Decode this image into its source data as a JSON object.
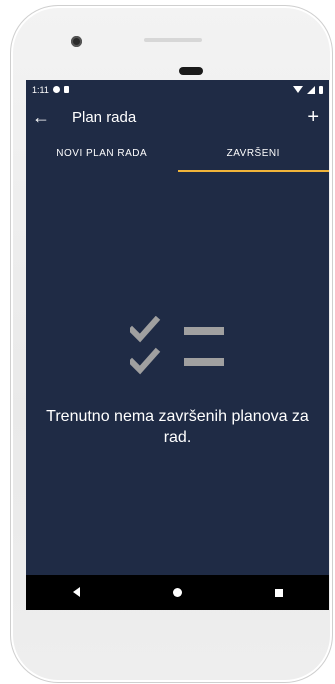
{
  "status_bar": {
    "time": "1:11"
  },
  "app_bar": {
    "title": "Plan rada",
    "back_icon": "arrow-back-icon",
    "add_icon": "plus-icon"
  },
  "tabs": [
    {
      "label": "NOVI PLAN RADA",
      "active": false
    },
    {
      "label": "ZAVRŠENI",
      "active": true
    }
  ],
  "empty_state": {
    "icon": "checklist-icon",
    "message": "Trenutno nema završenih planova za rad."
  },
  "colors": {
    "screen_bg": "#1f2b45",
    "tab_indicator": "#f0b43a",
    "icon_gray": "#a0a0a0"
  }
}
